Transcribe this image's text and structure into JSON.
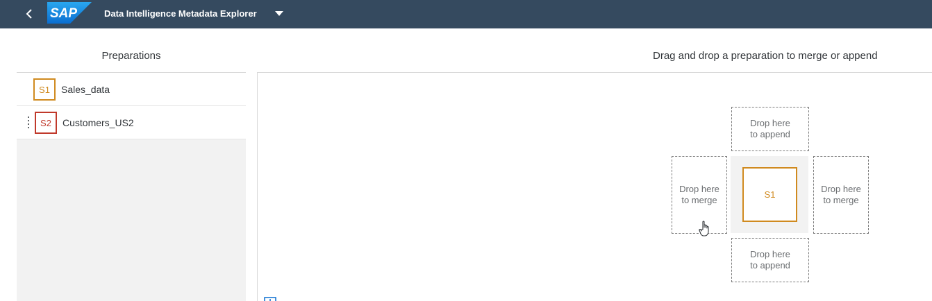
{
  "shell": {
    "logo_text": "SAP",
    "app_title": "Data Intelligence Metadata Explorer",
    "back_icon": "chevron-left-icon",
    "title_menu_icon": "caret-down-icon"
  },
  "preparations": {
    "header": "Preparations",
    "items": [
      {
        "badge": "S1",
        "name": "Sales_data",
        "color": "#d08a1f"
      },
      {
        "badge": "S2",
        "name": "Customers_US2",
        "color": "#c0392b"
      }
    ]
  },
  "canvas": {
    "header": "Drag and drop a preparation to merge or append",
    "center_node": "S1",
    "center_color": "#d08a1f",
    "drop_top": {
      "line1": "Drop here",
      "line2": "to append"
    },
    "drop_bottom": {
      "line1": "Drop here",
      "line2": "to append"
    },
    "drop_left": {
      "line1": "Drop here",
      "line2": "to merge"
    },
    "drop_right": {
      "line1": "Drop here",
      "line2": "to merge"
    }
  },
  "colors": {
    "shellbar": "#354a5f",
    "panel_bg": "#f2f2f2",
    "s1_accent": "#d08a1f",
    "s2_accent": "#c0392b"
  }
}
